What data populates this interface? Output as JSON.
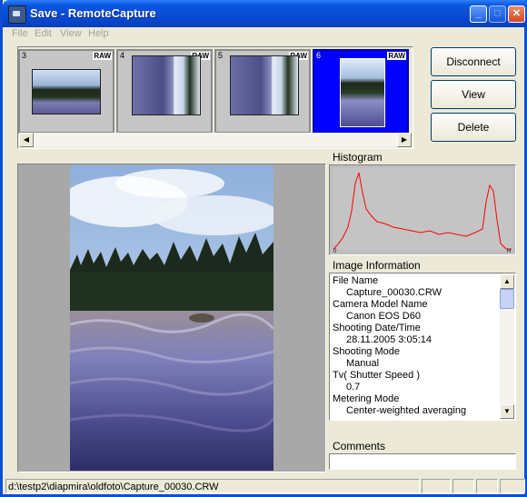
{
  "window": {
    "title": "Save - RemoteCapture",
    "minimize": "_",
    "maximize": "□",
    "close": "✕"
  },
  "menu": {
    "items": [
      "File",
      "Edit",
      "View",
      "Help"
    ]
  },
  "thumbnails": [
    {
      "number": "3",
      "badge": "RAW",
      "selected": false
    },
    {
      "number": "4",
      "badge": "RAW",
      "selected": false
    },
    {
      "number": "5",
      "badge": "RAW",
      "selected": false
    },
    {
      "number": "6",
      "badge": "RAW",
      "selected": true
    }
  ],
  "scroll": {
    "left_arrow": "◀",
    "right_arrow": "▶",
    "up_arrow": "▲",
    "down_arrow": "▼"
  },
  "buttons": {
    "disconnect": "Disconnect",
    "view": "View",
    "delete": "Delete"
  },
  "histogram": {
    "label": "Histogram",
    "axis_min": "0",
    "axis_max": "H"
  },
  "image_info": {
    "label": "Image Information",
    "lines": [
      {
        "text": "File Name",
        "kind": "key"
      },
      {
        "text": "Capture_00030.CRW",
        "kind": "val"
      },
      {
        "text": "Camera Model Name",
        "kind": "key"
      },
      {
        "text": "Canon EOS D60",
        "kind": "val"
      },
      {
        "text": "Shooting Date/Time",
        "kind": "key"
      },
      {
        "text": "28.11.2005 3:05:14",
        "kind": "val"
      },
      {
        "text": "Shooting Mode",
        "kind": "key"
      },
      {
        "text": "Manual",
        "kind": "val"
      },
      {
        "text": "Tv( Shutter Speed )",
        "kind": "key"
      },
      {
        "text": "0.7",
        "kind": "val"
      },
      {
        "text": "Metering Mode",
        "kind": "key"
      },
      {
        "text": "Center-weighted averaging",
        "kind": "val"
      }
    ]
  },
  "comments": {
    "label": "Comments",
    "value": ""
  },
  "status": {
    "path": "d:\\testp2\\diapmira\\oldfoto\\Capture_00030.CRW"
  },
  "colors": {
    "titlebar": "#0a55e0",
    "selected_thumb": "#0000ff",
    "histogram_line": "#ff0000"
  }
}
